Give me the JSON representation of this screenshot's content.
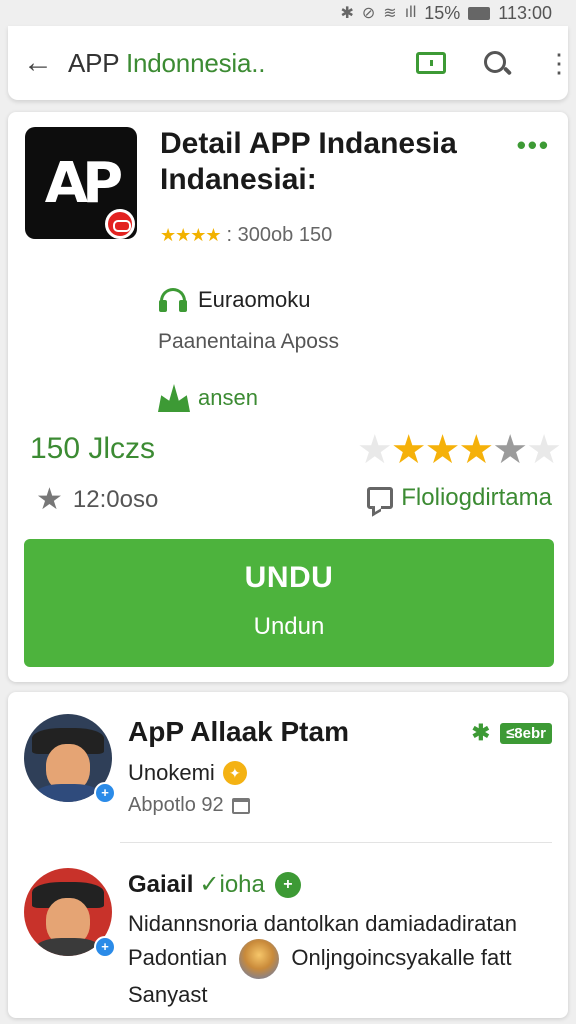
{
  "status_bar": {
    "battery": "15%",
    "time": "113:00"
  },
  "app_bar": {
    "title_prefix": "APP",
    "title_highlight": "Indonnesia..",
    "back_icon": "arrow-back-icon",
    "actions": [
      "bookmark-icon",
      "search-icon",
      "more-vert-icon"
    ]
  },
  "detail": {
    "logo_text": "AP",
    "title_line1": "Detail APP  Indanesia",
    "title_line2": "Indanesiai:",
    "more": "•••",
    "rating_stars": "★★★★",
    "rating_text": ": 300ob 150",
    "developer": "Euraomoku",
    "developer_sub": "Paanentaina Aposs",
    "tag": "ansen",
    "downloads": "150 Jlczs",
    "rating_value": 3.5,
    "reviews_count": "12:0oso",
    "reviews_link": "Floliogdirtama",
    "install_label": "UNDU",
    "install_sub": "Undun",
    "colors": {
      "accent_green": "#4db33d",
      "text_green": "#3c8b33",
      "star_gold": "#f5b10a"
    }
  },
  "reviews": {
    "items": [
      {
        "name": "ApP  Allaak Ptam",
        "tag": "≤8ebr",
        "subtitle": "Unokemi",
        "meta": "Abpotlo 92"
      },
      {
        "name_prefix": "Gaiail",
        "name_highlight": "✓ioha",
        "text_line1": "Nidannsnoria dantolkan damiadadiratan",
        "text_line2_a": "Padontian",
        "text_line2_b": "Onljngoincsyakalle fatt",
        "text_line3": "Sanyast"
      }
    ]
  }
}
